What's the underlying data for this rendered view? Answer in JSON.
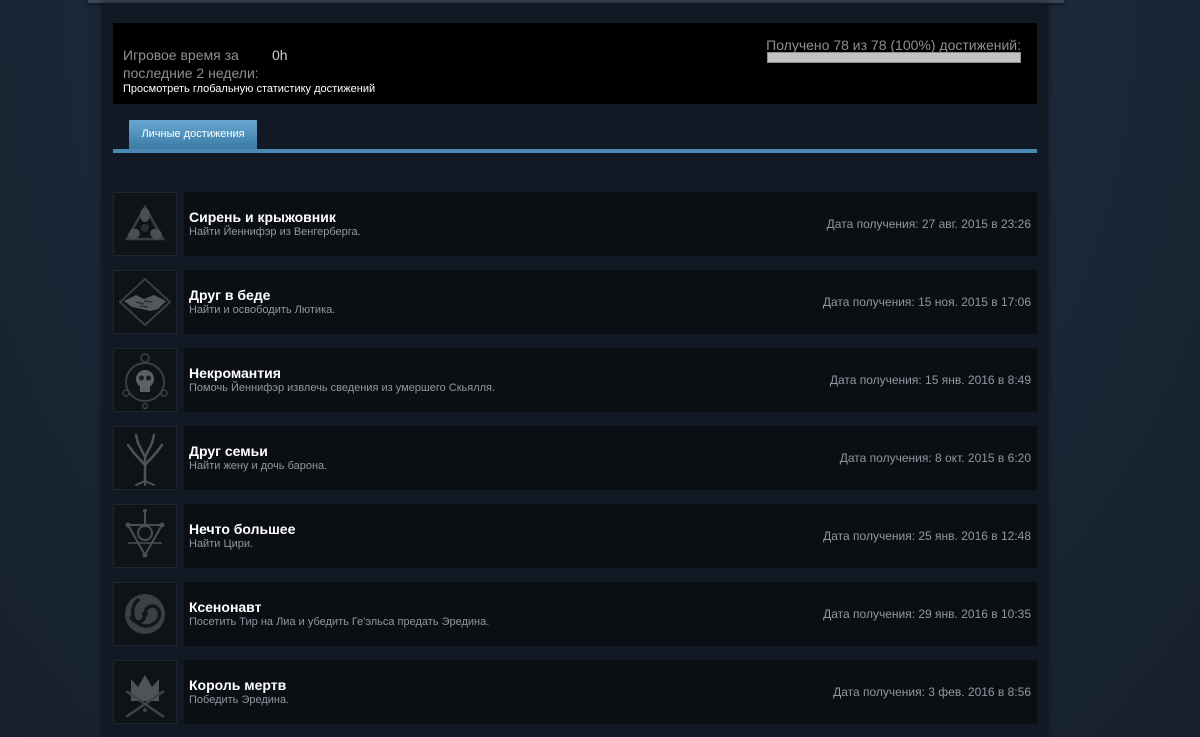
{
  "stats": {
    "playtime_label": "Игровое время за последние 2 недели:",
    "playtime_value": "0h",
    "global_stats_link": "Просмотреть глобальную статистику достижений",
    "progress_text": "Получено 78 из 78 (100%) достижений:",
    "progress_fraction": 1.0
  },
  "tabs": {
    "personal": "Личные достижения"
  },
  "achievements": [
    {
      "title": "Сирень и крыжовник",
      "description": "Найти Йеннифэр из Венгерберга.",
      "date": "Дата получения: 27 авг. 2015 в 23:26",
      "icon": "triangle-sigil-icon"
    },
    {
      "title": "Друг в беде",
      "description": "Найти и освободить Лютика.",
      "date": "Дата получения: 15 ноя. 2015 в 17:06",
      "icon": "handshake-icon"
    },
    {
      "title": "Некромантия",
      "description": "Помочь Йеннифэр извлечь сведения из умершего Скьялля.",
      "date": "Дата получения: 15 янв. 2016 в 8:49",
      "icon": "skull-circle-icon"
    },
    {
      "title": "Друг семьи",
      "description": "Найти жену и дочь барона.",
      "date": "Дата получения: 8 окт. 2015 в 6:20",
      "icon": "tree-icon"
    },
    {
      "title": "Нечто большее",
      "description": "Найти Цири.",
      "date": "Дата получения: 25 янв. 2016 в 12:48",
      "icon": "star-sigil-icon"
    },
    {
      "title": "Ксенонавт",
      "description": "Посетить Тир на Лиа и убедить Ге'эльса предать Эредина.",
      "date": "Дата получения: 29 янв. 2016 в 10:35",
      "icon": "spiral-icon"
    },
    {
      "title": "Король мертв",
      "description": "Победить Эредина.",
      "date": "Дата получения: 3 фев. 2016 в 8:56",
      "icon": "crown-icon"
    }
  ]
}
